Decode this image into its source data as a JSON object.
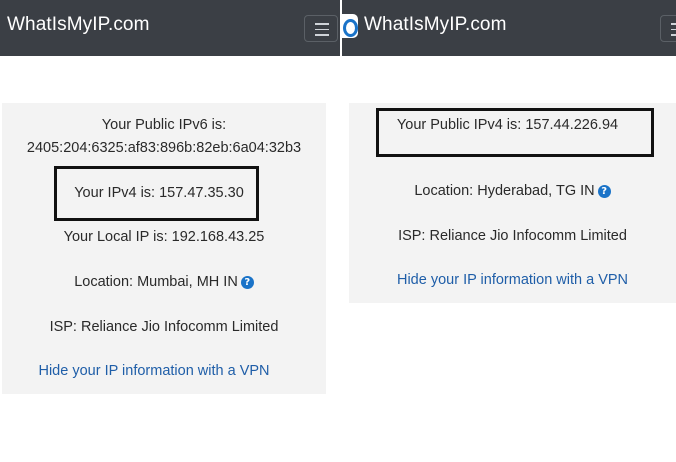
{
  "left": {
    "header": {
      "brand": "WhatIsMyIP.com"
    },
    "ipv6_label": "Your Public IPv6 is:",
    "ipv6_value": "2405:204:6325:af83:896b:82eb:6a04:32b3",
    "ipv4_text": "Your IPv4 is: 157.47.35.30",
    "local_ip_text": "Your Local IP is: 192.168.43.25",
    "location_text": "Location: Mumbai, MH IN",
    "isp_text": "ISP: Reliance Jio Infocomm Limited",
    "vpn_link": "Hide your IP information with a VPN"
  },
  "right": {
    "header": {
      "brand": "WhatIsMyIP.com"
    },
    "ipv4_text": "Your Public IPv4 is: 157.44.226.94",
    "location_text": "Location: Hyderabad, TG IN",
    "isp_text": "ISP: Reliance Jio Infocomm Limited",
    "vpn_link": "Hide your IP information with a VPN"
  },
  "icons": {
    "help": "question-circle-icon",
    "menu": "hamburger-menu-icon",
    "logo": "whatismyip-logo-icon"
  },
  "colors": {
    "header_bg": "#3b3f45",
    "card_bg": "#f3f3f3",
    "link": "#1f5ea8",
    "help_icon": "#1a73c8"
  }
}
